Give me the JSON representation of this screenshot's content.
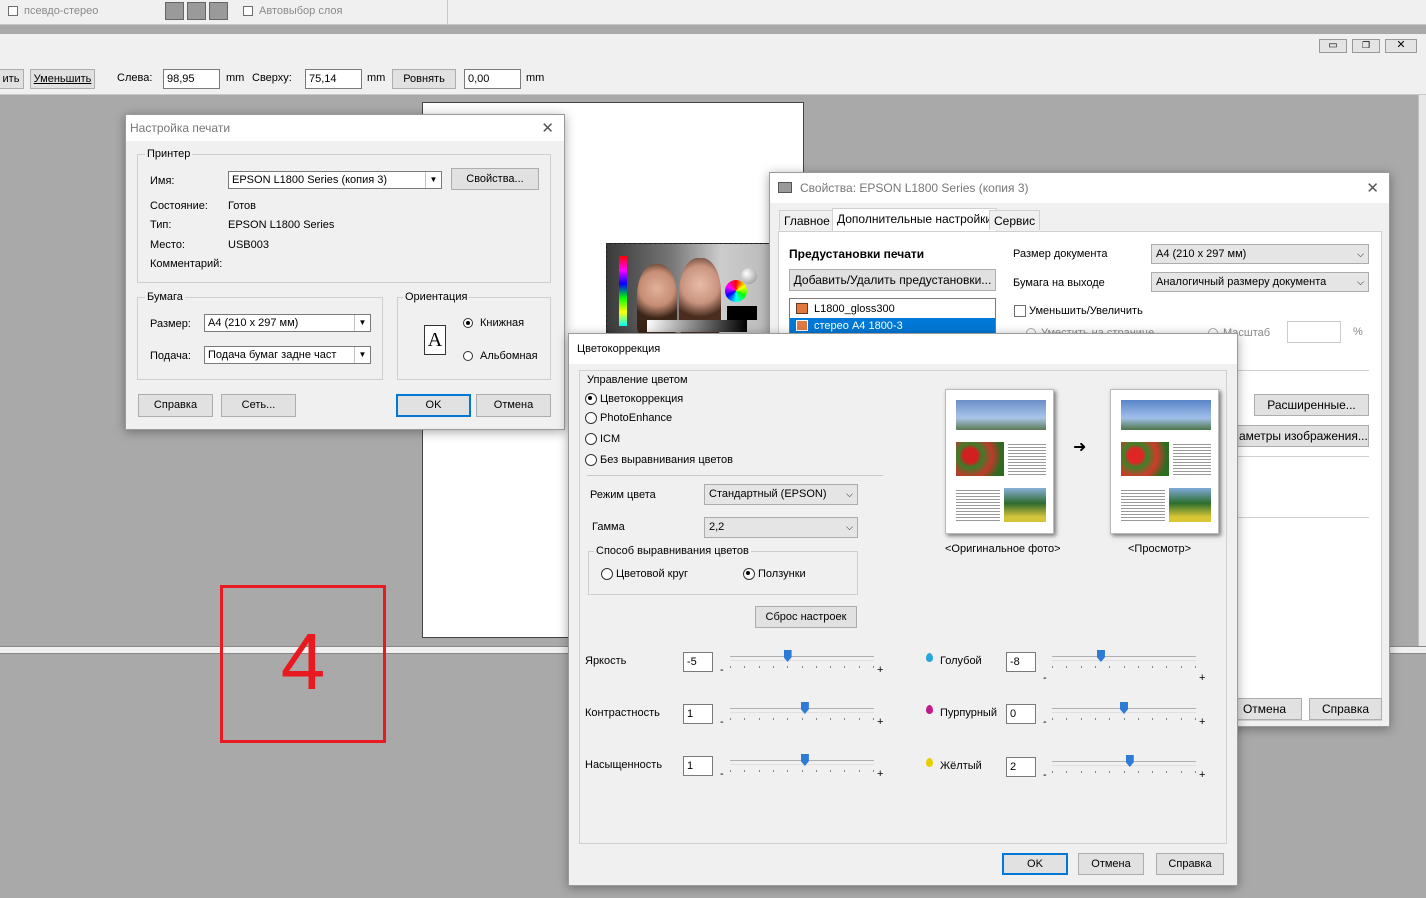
{
  "topbar": {
    "pseudo_stereo": "псевдо-стерео",
    "auto_layer": "Автовыбор слоя"
  },
  "toolbar": {
    "enlarge": "ить",
    "reduce": "Уменьшить",
    "left_label": "Слева:",
    "left_value": "98,95",
    "unit1": "mm",
    "top_label": "Сверху:",
    "top_value": "75,14",
    "unit2": "mm",
    "align": "Ровнять",
    "extra_value": "0,00",
    "unit3": "mm"
  },
  "print_setup": {
    "title": "Настройка печати",
    "printer_group": "Принтер",
    "name_label": "Имя:",
    "name_value": "EPSON L1800 Series (копия 3)",
    "properties": "Свойства...",
    "status_label": "Состояние:",
    "status_value": "Готов",
    "type_label": "Тип:",
    "type_value": "EPSON L1800 Series",
    "where_label": "Место:",
    "where_value": "USB003",
    "comment_label": "Комментарий:",
    "paper_group": "Бумага",
    "size_label": "Размер:",
    "size_value": "A4 (210 x 297 мм)",
    "source_label": "Подача:",
    "source_value": "Подача бумаг задне част",
    "orientation_group": "Ориентация",
    "orientation_glyph": "A",
    "portrait": "Книжная",
    "landscape": "Альбомная",
    "help": "Справка",
    "network": "Сеть...",
    "ok": "OK",
    "cancel": "Отмена"
  },
  "properties_dialog": {
    "title": "Свойства: EPSON L1800 Series (копия 3)",
    "tabs": [
      "Главное",
      "Дополнительные настройки",
      "Сервис"
    ],
    "presets_heading": "Предустановки печати",
    "add_remove": "Добавить/Удалить предустановки...",
    "presets": [
      "L1800_gloss300",
      "стерео A4 1800-3"
    ],
    "doc_size_label": "Размер документа",
    "doc_size_value": "A4 (210 x 297 мм)",
    "output_paper_label": "Бумага на выходе",
    "output_paper_value": "Аналогичный размеру документа",
    "reduce_enlarge": "Уменьшить/Увеличить",
    "fit_page": "Уместить на странице",
    "scale": "Масштаб",
    "percent": "%",
    "advanced": "Расширенные...",
    "image_params": "аметры изображения...",
    "cancel": "Отмена",
    "help": "Справка"
  },
  "color_dialog": {
    "title": "Цветокоррекция",
    "mgmt_group": "Управление цветом",
    "options": [
      "Цветокоррекция",
      "PhotoEnhance",
      "ICM",
      "Без выравнивания цветов"
    ],
    "color_mode_label": "Режим цвета",
    "color_mode_value": "Стандартный (EPSON)",
    "gamma_label": "Гамма",
    "gamma_value": "2,2",
    "method_group": "Способ выравнивания цветов",
    "color_circle": "Цветовой круг",
    "sliders_opt": "Ползунки",
    "reset": "Сброс настроек",
    "original": "<Оригинальное фото>",
    "preview": "<Просмотр>",
    "arrow": "➜",
    "minus": "-",
    "plus": "+",
    "brightness_label": "Яркость",
    "brightness": -5,
    "brightness_text": "-5",
    "contrast_label": "Контрастность",
    "contrast": 1,
    "contrast_text": "1",
    "saturation_label": "Насыщенность",
    "saturation": 1,
    "saturation_text": "1",
    "cyan_label": "Голубой",
    "cyan": -8,
    "cyan_text": "-8",
    "magenta_label": "Пурпурный",
    "magenta": 0,
    "magenta_text": "0",
    "yellow_label": "Жёлтый",
    "yellow": 2,
    "yellow_text": "2",
    "ok": "OK",
    "cancel": "Отмена",
    "help": "Справка"
  },
  "annotation": {
    "number": "4",
    "color": "#e8191f"
  }
}
